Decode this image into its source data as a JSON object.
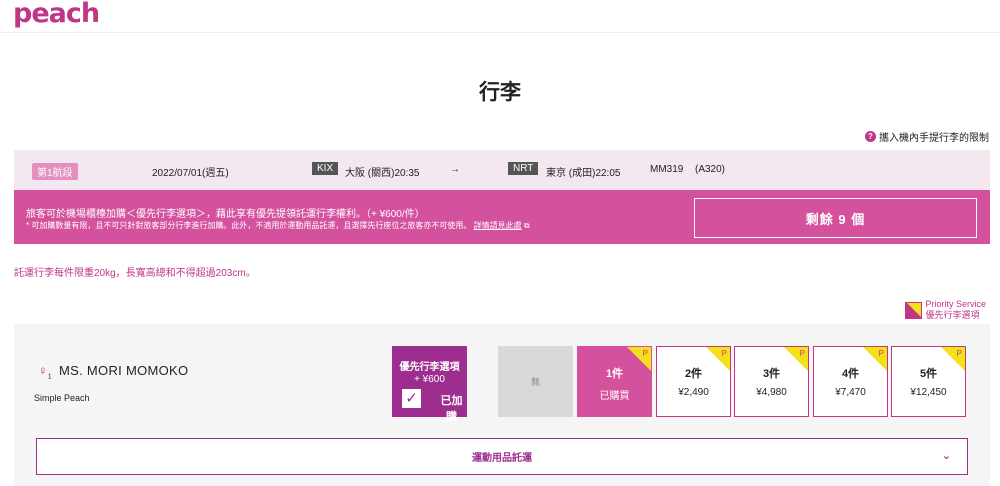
{
  "header": {
    "logo": "peach"
  },
  "page": {
    "title": "行李"
  },
  "carry_on_link": {
    "icon": "question-icon",
    "text": "攜入機內手提行李的限制"
  },
  "flight": {
    "segment": "第1航段",
    "date": "2022/07/01(週五)",
    "origin_code": "KIX",
    "origin": "大阪 (關西)20:35",
    "arrow": "→",
    "dest_code": "NRT",
    "dest": "東京 (成田)22:05",
    "flight_no": "MM319",
    "aircraft": "(A320)"
  },
  "promo": {
    "line1": "旅客可於機場櫃檯加購＜優先行李選項＞，藉此享有優先提領託運行李權利。（+ ¥600/件）",
    "line2": "* 可加購數量有限，且不可只針對旅客部分行李進行加購。此外，不適用於運動用品託運，且選擇先行座位之旅客亦不可使用。",
    "link": "詳情請見此處",
    "remaining": "剩餘 9 個"
  },
  "weight_note": "託運行李每件限重20kg，長寬高總和不得超過203cm。",
  "priority_legend": {
    "line1": "Priority Service",
    "line2": "優先行李選項"
  },
  "passenger": {
    "icon": "person-icon",
    "index": "1",
    "name": "MS. MORI MOMOKO",
    "fare": "Simple Peach"
  },
  "priority_option": {
    "title": "優先行李選項",
    "price": "+ ¥600",
    "status": "已加購"
  },
  "none_option": {
    "label": "無"
  },
  "options": [
    {
      "count": "1件",
      "price": "已購買",
      "badge": "P",
      "selected": true
    },
    {
      "count": "2件",
      "price": "¥2,490",
      "badge": "P",
      "selected": false
    },
    {
      "count": "3件",
      "price": "¥4,980",
      "badge": "P",
      "selected": false
    },
    {
      "count": "4件",
      "price": "¥7,470",
      "badge": "P",
      "selected": false
    },
    {
      "count": "5件",
      "price": "¥12,450",
      "badge": "P",
      "selected": false
    }
  ],
  "sports": {
    "label": "運動用品託運"
  },
  "colors": {
    "brand": "#c13587",
    "promo": "#d4519e",
    "purple": "#9d2d8e",
    "corner": "#f5e11a"
  }
}
